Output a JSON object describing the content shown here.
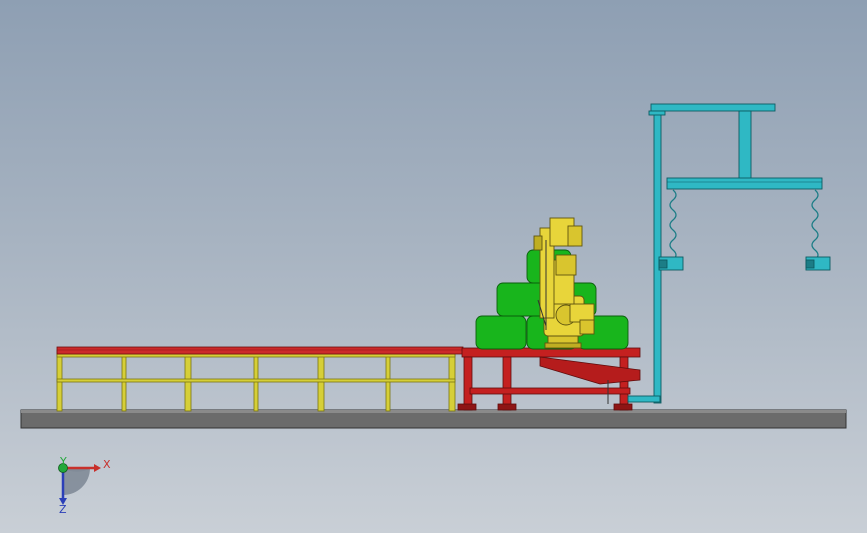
{
  "viewport": {
    "background_top": "#8e9fb3",
    "background_bottom": "#c9cfd6"
  },
  "triad": {
    "x_label": "X",
    "y_label": "Y",
    "z_label": "Z",
    "x_color": "#c8302b",
    "y_color": "#22a83a",
    "z_color": "#2b3fb8"
  },
  "model": {
    "colors": {
      "base_plate": "#6b6b6b",
      "conveyor_frame": "#d6cf38",
      "conveyor_top": "#cc2a2a",
      "table": "#c42020",
      "gantry": "#2fb8c4",
      "robot": "#e8d53a",
      "bags": "#18b51c"
    },
    "icons": [
      "coordinate-triad-icon",
      "robot-arm-icon",
      "spring-cable-icon",
      "gripper-icon"
    ]
  }
}
